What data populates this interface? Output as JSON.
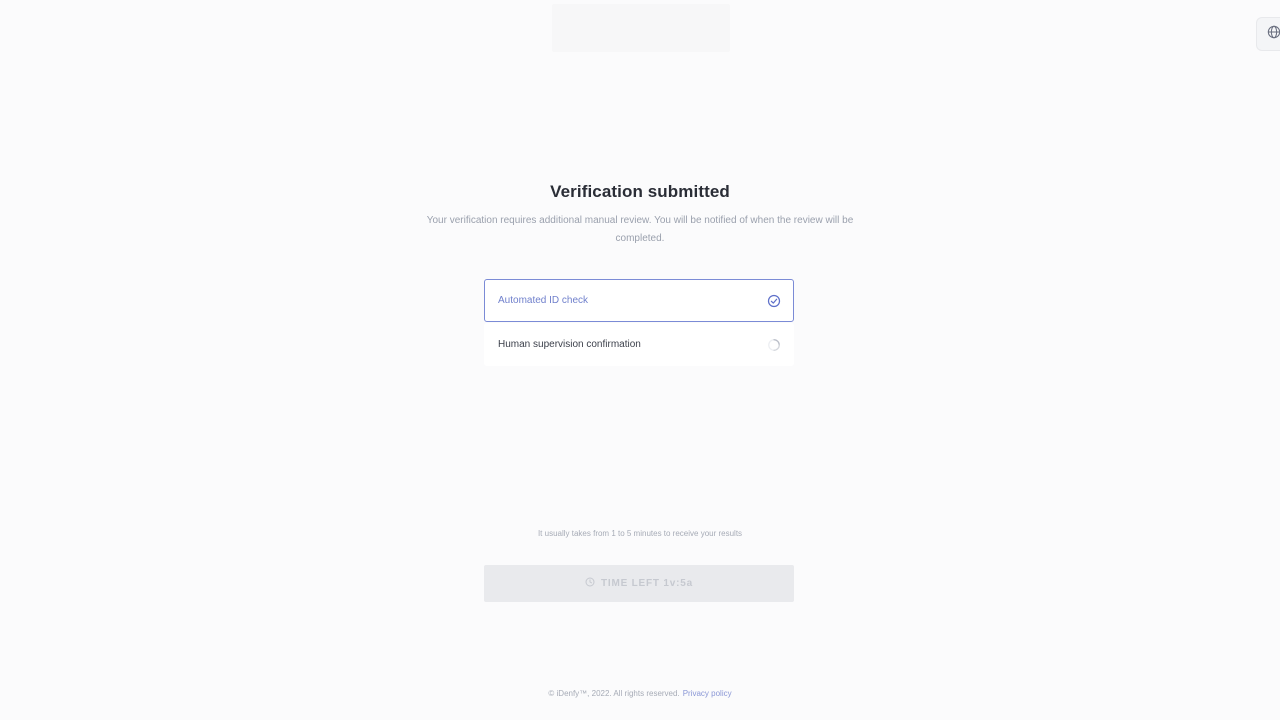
{
  "header": {
    "language_icon": "globe-icon"
  },
  "main": {
    "title": "Verification submitted",
    "subtitle": "Your verification requires additional manual review. You will be notified of when the review will be completed.",
    "steps": [
      {
        "label": "Automated ID check",
        "status": "done",
        "icon": "check-circle-icon"
      },
      {
        "label": "Human supervision confirmation",
        "status": "in-progress",
        "icon": "spinner-icon"
      }
    ],
    "info": "It usually takes from 1 to 5 minutes to receive your results",
    "timer_label": "TIME LEFT 1v:5а",
    "timer_icon": "clock-icon"
  },
  "footer": {
    "copyright": "© iDenfy™, 2022. All rights reserved.",
    "privacy_link": "Privacy policy"
  },
  "colors": {
    "accent": "#7b8bd6",
    "background": "#fbfbfc",
    "button_disabled": "#e9eaed"
  }
}
